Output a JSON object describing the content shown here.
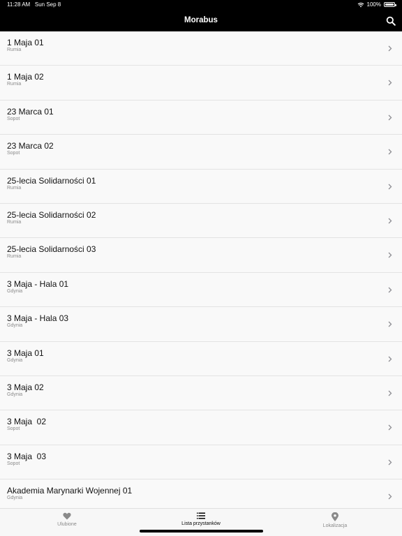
{
  "status_bar": {
    "time": "11:28 AM",
    "date": "Sun Sep 8",
    "battery": "100%"
  },
  "header": {
    "title": "Morabus"
  },
  "stops": [
    {
      "name": "1 Maja 01",
      "city": "Rumia"
    },
    {
      "name": "1 Maja 02",
      "city": "Rumia"
    },
    {
      "name": "23 Marca 01",
      "city": "Sopot"
    },
    {
      "name": "23 Marca 02",
      "city": "Sopot"
    },
    {
      "name": "25-lecia Solidarności 01",
      "city": "Rumia"
    },
    {
      "name": "25-lecia Solidarności 02",
      "city": "Rumia"
    },
    {
      "name": "25-lecia Solidarności 03",
      "city": "Rumia"
    },
    {
      "name": "3 Maja - Hala 01",
      "city": "Gdynia"
    },
    {
      "name": "3 Maja - Hala 03",
      "city": "Gdynia"
    },
    {
      "name": "3 Maja 01",
      "city": "Gdynia"
    },
    {
      "name": "3 Maja 02",
      "city": "Gdynia"
    },
    {
      "name": "3 Maja  02",
      "city": "Sopot"
    },
    {
      "name": "3 Maja  03",
      "city": "Sopot"
    },
    {
      "name": "Akademia Marynarki Wojennej 01",
      "city": "Gdynia"
    }
  ],
  "tabs": [
    {
      "label": "Ulubione",
      "icon": "heart-icon",
      "active": false
    },
    {
      "label": "Lista przystanków",
      "icon": "list-icon",
      "active": true
    },
    {
      "label": "Lokalizacja",
      "icon": "location-pin-icon",
      "active": false
    }
  ],
  "colors": {
    "header_bg": "#000000",
    "active_tab": "#000000",
    "inactive_tab": "#8a8a8a"
  }
}
